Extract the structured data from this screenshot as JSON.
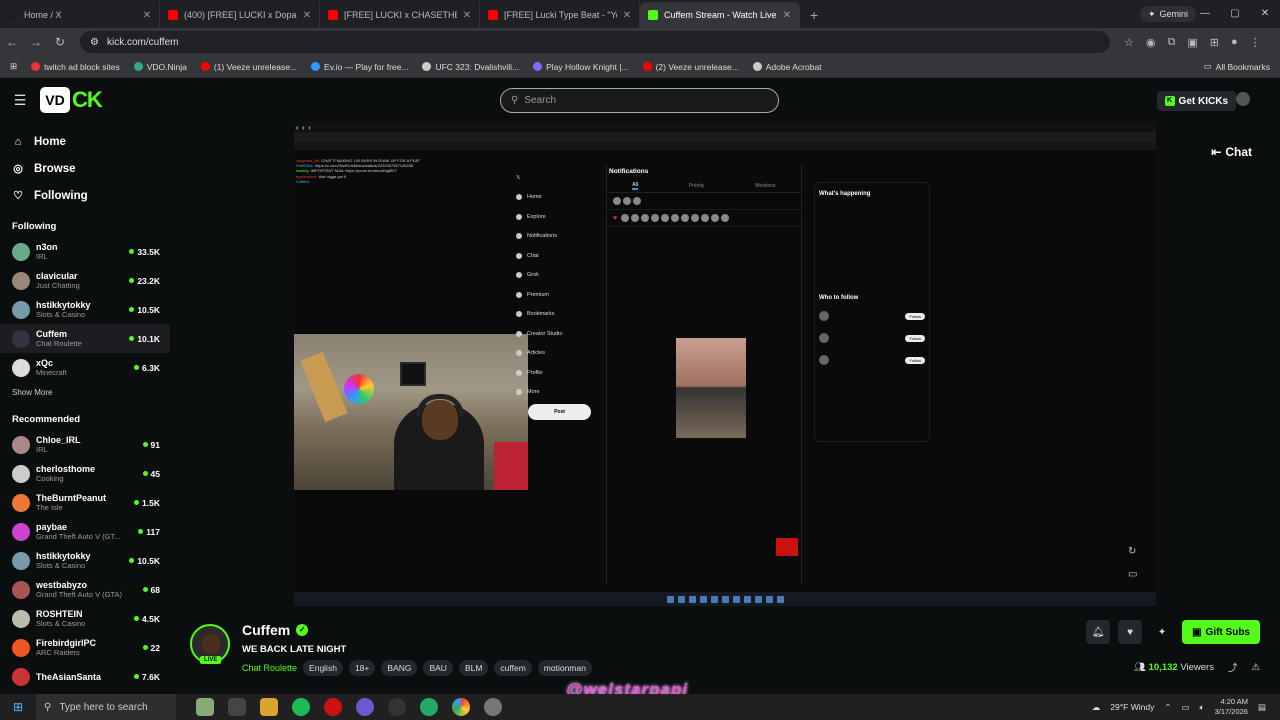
{
  "browser": {
    "tabs": [
      {
        "label": "Home / X",
        "color": "#1d1d1d"
      },
      {
        "label": "(400) [FREE] LUCKI x Dopamine",
        "color": "#ff0000"
      },
      {
        "label": "[FREE] LUCKI x CHASETHEMONEY",
        "color": "#ff0000"
      },
      {
        "label": "[FREE] Lucki Type Beat - \"You G",
        "color": "#ff0000"
      },
      {
        "label": "Cuffem Stream - Watch Live",
        "color": "#53fc18",
        "active": true
      }
    ],
    "gemini_label": "Gemini",
    "url": "kick.com/cuffem",
    "bookmarks": [
      {
        "label": "twitch ad block sites",
        "color": "#e33"
      },
      {
        "label": "VDO.Ninja",
        "color": "#3a8"
      },
      {
        "label": "(1) Veeze unrelease...",
        "color": "#f00"
      },
      {
        "label": "Ev.io — Play for free...",
        "color": "#39f"
      },
      {
        "label": "UFC 323: Dvalishvili...",
        "color": "#ccc"
      },
      {
        "label": "Play Hollow Knight |...",
        "color": "#86f"
      },
      {
        "label": "(2) Veeze unrelease...",
        "color": "#f00"
      },
      {
        "label": "Adobe Acrobat",
        "color": "#ccc"
      }
    ],
    "all_bookmarks": "All Bookmarks"
  },
  "kick": {
    "search_placeholder": "Search",
    "get_kicks": "Get KICKs",
    "chat_label": "Chat",
    "nav": [
      {
        "label": "Home",
        "icon": "home-icon",
        "glyph": "⌂"
      },
      {
        "label": "Browse",
        "icon": "browse-icon",
        "glyph": "◎"
      },
      {
        "label": "Following",
        "icon": "heart-icon",
        "glyph": "♡"
      }
    ],
    "following_header": "Following",
    "following": [
      {
        "name": "n3on",
        "category": "IRL",
        "viewers": "33.5K",
        "color": "#6a8"
      },
      {
        "name": "clavicular",
        "category": "Just Chatting",
        "viewers": "23.2K",
        "color": "#987"
      },
      {
        "name": "hstikkytokky",
        "category": "Slots & Casino",
        "viewers": "10.5K",
        "color": "#79a"
      },
      {
        "name": "Cuffem",
        "category": "Chat Roulette",
        "viewers": "10.1K",
        "color": "#334",
        "active": true
      },
      {
        "name": "xQc",
        "category": "Minecraft",
        "viewers": "6.3K",
        "color": "#ddd"
      }
    ],
    "show_more": "Show More",
    "recommended_header": "Recommended",
    "recommended": [
      {
        "name": "Chloe_IRL",
        "category": "IRL",
        "viewers": "91",
        "color": "#a88"
      },
      {
        "name": "cherlosthome",
        "category": "Cooking",
        "viewers": "45",
        "color": "#ccc"
      },
      {
        "name": "TheBurntPeanut",
        "category": "The Isle",
        "viewers": "1.5K",
        "color": "#e73"
      },
      {
        "name": "paybae",
        "category": "Grand Theft Auto V (GT...",
        "viewers": "117",
        "color": "#c4c"
      },
      {
        "name": "hstikkytokky",
        "category": "Slots & Casino",
        "viewers": "10.5K",
        "color": "#79a"
      },
      {
        "name": "westbabyzo",
        "category": "Grand Theft Auto V (GTA)",
        "viewers": "68",
        "color": "#a55"
      },
      {
        "name": "ROSHTEIN",
        "category": "Slots & Casino",
        "viewers": "4.5K",
        "color": "#bba"
      },
      {
        "name": "FirebirdgirlPC",
        "category": "ARC Raiders",
        "viewers": "22",
        "color": "#e52"
      },
      {
        "name": "TheAsianSanta",
        "category": "",
        "viewers": "7.6K",
        "color": "#c33"
      }
    ],
    "stream": {
      "name": "Cuffem",
      "title": "WE BACK LATE NIGHT",
      "live_badge": "LIVE",
      "category": "Chat Roulette",
      "tags": [
        "English",
        "18+",
        "BANG",
        "BAU",
        "BLM",
        "cuffem",
        "motionman"
      ],
      "gift_subs": "Gift Subs",
      "viewer_count": "10,132",
      "viewers_label": "Viewers"
    }
  },
  "video": {
    "x_nav": [
      "Home",
      "Explore",
      "Notifications",
      "Chat",
      "Grok",
      "Premium",
      "Bookmarks",
      "Creator Studio",
      "Articles",
      "Profile",
      "More"
    ],
    "post_label": "Post",
    "notifications_title": "Notifications",
    "notif_tabs": [
      "All",
      "Priority",
      "Mentions"
    ],
    "whats_happening": "What's happening",
    "who_to_follow": "Who to follow",
    "follow_label": "Follow",
    "chat_lines": [
      {
        "user": "capybara_88:",
        "text": "CHATTI MAKING 100 BARS IN RANK UP FOR A FEAT",
        "cls": "u"
      },
      {
        "user": "OneOfUs:",
        "text": "https://x.com/SadSomMiaus/status/2032657357126438",
        "cls": "u2"
      },
      {
        "user": "lossing:",
        "text": "IMPORTANT MAIL https://youtu.be/anodkhg8f07",
        "cls": "u3"
      },
      {
        "user": "epplesauce:",
        "text": "that nigga got it",
        "cls": "u"
      },
      {
        "user": "Cuffem:",
        "text": "",
        "cls": "u2"
      }
    ],
    "watermark": "@welstarpapi"
  },
  "taskbar": {
    "search_placeholder": "Type here to search",
    "weather": "29°F  Windy",
    "time": "4:20 AM",
    "date": "3/17/2026"
  }
}
